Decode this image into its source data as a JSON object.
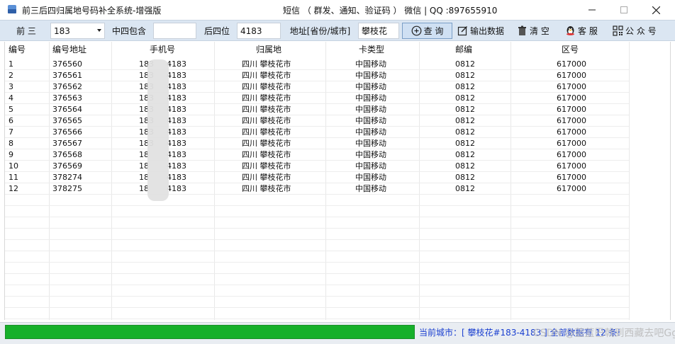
{
  "window": {
    "title": "前三后四归属地号码补全系统-增强版",
    "center_text": "短信 （ 群发、通知、验证码 ） 微信 | QQ :897655910",
    "min_icon": "minimize-icon",
    "max_icon": "maximize-icon",
    "close_icon": "close-icon"
  },
  "toolbar": {
    "prefix_label": "前  三",
    "prefix_value": "183",
    "middle_label": "中四包含",
    "middle_value": "",
    "suffix_label": "后四位",
    "suffix_value": "4183",
    "address_label": "地址[省份/城市]",
    "address_value": "攀枝花",
    "query_label": "查  询",
    "export_label": "输出数据",
    "clear_label": "清  空",
    "service_label": "客  服",
    "public_label": "公 众 号"
  },
  "table": {
    "columns": [
      "编号",
      "编号地址",
      "手机号",
      "归属地",
      "卡类型",
      "邮编",
      "区号"
    ],
    "rows": [
      {
        "no": "1",
        "addr": "376560",
        "phone_a": "183",
        "phone_b": "4183",
        "loc": "四川  攀枝花市",
        "type": "中国移动",
        "zip": "0812",
        "area": "617000"
      },
      {
        "no": "2",
        "addr": "376561",
        "phone_a": "183",
        "phone_b": "4183",
        "loc": "四川  攀枝花市",
        "type": "中国移动",
        "zip": "0812",
        "area": "617000"
      },
      {
        "no": "3",
        "addr": "376562",
        "phone_a": "183",
        "phone_b": "4183",
        "loc": "四川  攀枝花市",
        "type": "中国移动",
        "zip": "0812",
        "area": "617000"
      },
      {
        "no": "4",
        "addr": "376563",
        "phone_a": "183",
        "phone_b": "4183",
        "loc": "四川  攀枝花市",
        "type": "中国移动",
        "zip": "0812",
        "area": "617000"
      },
      {
        "no": "5",
        "addr": "376564",
        "phone_a": "183",
        "phone_b": "4183",
        "loc": "四川  攀枝花市",
        "type": "中国移动",
        "zip": "0812",
        "area": "617000"
      },
      {
        "no": "6",
        "addr": "376565",
        "phone_a": "183",
        "phone_b": "4183",
        "loc": "四川  攀枝花市",
        "type": "中国移动",
        "zip": "0812",
        "area": "617000"
      },
      {
        "no": "7",
        "addr": "376566",
        "phone_a": "183",
        "phone_b": "4183",
        "loc": "四川  攀枝花市",
        "type": "中国移动",
        "zip": "0812",
        "area": "617000"
      },
      {
        "no": "8",
        "addr": "376567",
        "phone_a": "183",
        "phone_b": "4183",
        "loc": "四川  攀枝花市",
        "type": "中国移动",
        "zip": "0812",
        "area": "617000"
      },
      {
        "no": "9",
        "addr": "376568",
        "phone_a": "18",
        "phone_b": "4183",
        "loc": "四川  攀枝花市",
        "type": "中国移动",
        "zip": "0812",
        "area": "617000"
      },
      {
        "no": "10",
        "addr": "376569",
        "phone_a": "18",
        "phone_b": "4183",
        "loc": "四川  攀枝花市",
        "type": "中国移动",
        "zip": "0812",
        "area": "617000"
      },
      {
        "no": "11",
        "addr": "378274",
        "phone_a": "18",
        "phone_b": "4183",
        "loc": "四川  攀枝花市",
        "type": "中国移动",
        "zip": "0812",
        "area": "617000"
      },
      {
        "no": "12",
        "addr": "378275",
        "phone_a": "18",
        "phone_b": "4183",
        "loc": "四川  攀枝花市",
        "type": "中国移动",
        "zip": "0812",
        "area": "617000"
      }
    ]
  },
  "status": {
    "progress_percent": 100,
    "text": "当前城市：[ 攀枝花#183-4183 ] 全部数据有 12 条!",
    "watermark": "CSDN @蓝蓝巴戟到西藏去吧Gg"
  },
  "colors": {
    "toolbar_bg": "#dbe6f2",
    "progress": "#16b02a",
    "status_text": "#1a3fd0"
  }
}
